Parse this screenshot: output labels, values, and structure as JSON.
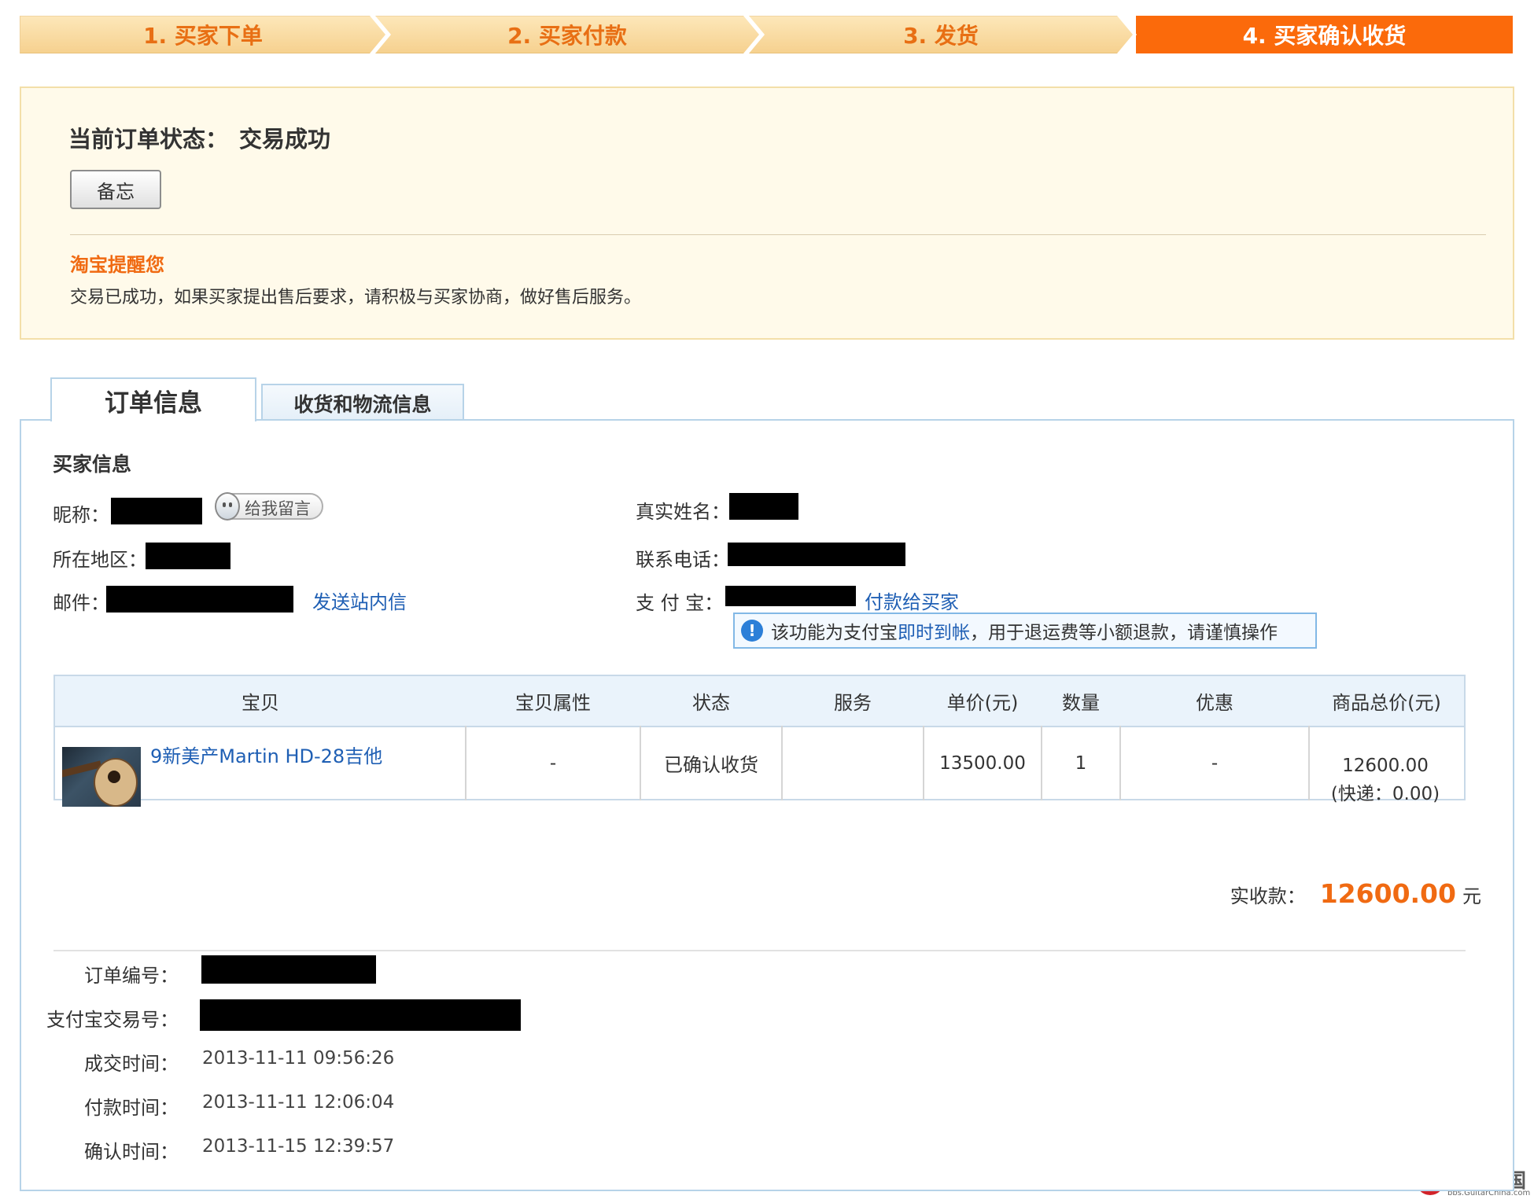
{
  "steps": [
    {
      "label": "1. 买家下单"
    },
    {
      "label": "2. 买家付款"
    },
    {
      "label": "3. 发货"
    },
    {
      "label": "4. 买家确认收货"
    }
  ],
  "status": {
    "label": "当前订单状态：",
    "value": "交易成功",
    "memo_button": "备忘",
    "reminder_title": "淘宝提醒您",
    "reminder_text": "交易已成功，如果买家提出售后要求，请积极与买家协商，做好售后服务。"
  },
  "tabs": [
    {
      "label": "订单信息",
      "active": true
    },
    {
      "label": "收货和物流信息",
      "active": false
    }
  ],
  "buyer": {
    "title": "买家信息",
    "nickname_label": "昵称：",
    "message_button": "给我留言",
    "region_label": "所在地区：",
    "email_label": "邮件：",
    "send_message_link": "发送站内信",
    "realname_label": "真实姓名：",
    "phone_label": "联系电话：",
    "alipay_label": "支 付 宝：",
    "pay_buyer_link": "付款给买家",
    "tip_prefix": "该功能为支付宝",
    "tip_highlight": "即时到帐",
    "tip_suffix": "，用于退运费等小额退款，请谨慎操作"
  },
  "goods_table": {
    "headers": [
      "宝贝",
      "宝贝属性",
      "状态",
      "服务",
      "单价(元)",
      "数量",
      "优惠",
      "商品总价(元)"
    ],
    "row": {
      "item_name": "9新美产Martin HD-28吉他",
      "attributes": "-",
      "status": "已确认收货",
      "service": "",
      "unit_price": "13500.00",
      "quantity": "1",
      "discount": "-",
      "total": "12600.00",
      "shipping": "(快递：0.00)"
    }
  },
  "summary": {
    "paid_label": "实收款：",
    "paid_amount": "12600.00",
    "paid_unit": "元"
  },
  "order_info": {
    "order_no_label": "订单编号：",
    "alipay_trade_label": "支付宝交易号：",
    "deal_time_label": "成交时间：",
    "deal_time": "2013-11-11 09:56:26",
    "pay_time_label": "付款时间：",
    "pay_time": "2013-11-11 12:06:04",
    "confirm_time_label": "确认时间：",
    "confirm_time": "2013-11-15 12:39:57"
  },
  "watermark": {
    "text": "吉他中国",
    "sub": "bbs.GuitarChina.com"
  },
  "colors": {
    "accent_orange": "#fb6a0b",
    "step_bg": "#f6d18f",
    "link_blue": "#1f5fb4",
    "panel_border": "#b7d3e8"
  }
}
